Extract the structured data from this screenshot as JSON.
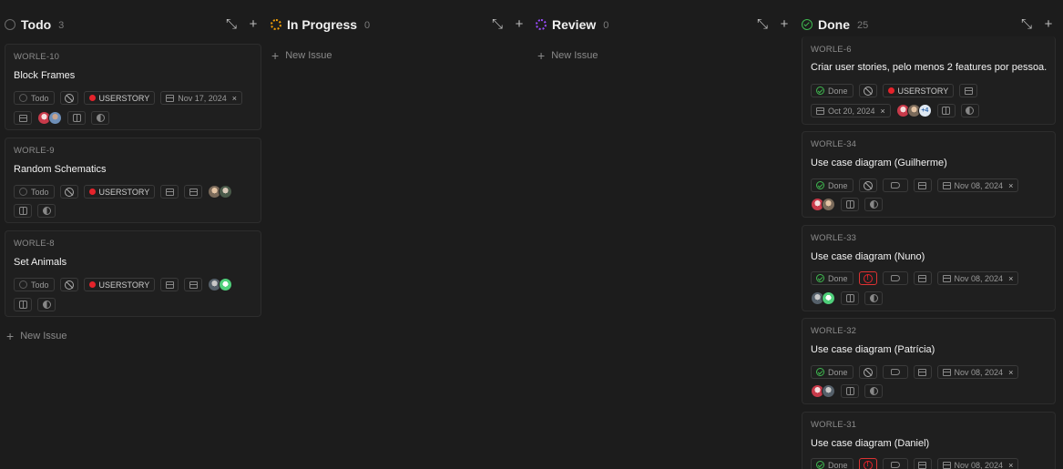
{
  "colors": {
    "todo": "#6b6b6b",
    "in_progress": "#f2a007",
    "review": "#9b4dff",
    "done": "#3fb950",
    "priority": "#e5232b"
  },
  "columns": [
    {
      "key": "todo",
      "title": "Todo",
      "count": "3",
      "icon": "todo-circle-icon"
    },
    {
      "key": "in_progress",
      "title": "In Progress",
      "count": "0",
      "icon": "in-progress-circle-icon"
    },
    {
      "key": "review",
      "title": "Review",
      "count": "0",
      "icon": "review-circle-icon"
    },
    {
      "key": "done",
      "title": "Done",
      "count": "25",
      "icon": "done-check-icon"
    }
  ],
  "new_issue_label": "New Issue",
  "todo_cards": [
    {
      "id": "WORLE-10",
      "title": "Block Frames",
      "state": "Todo",
      "label": "USERSTORY",
      "due": "Nov 17, 2024"
    },
    {
      "id": "WORLE-9",
      "title": "Random Schematics",
      "state": "Todo",
      "label": "USERSTORY"
    },
    {
      "id": "WORLE-8",
      "title": "Set Animals",
      "state": "Todo",
      "label": "USERSTORY"
    }
  ],
  "done_cards": [
    {
      "id": "WORLE-6",
      "title": "Criar user stories, pelo menos 2 features por pessoa.",
      "state": "Done",
      "label": "USERSTORY",
      "due": "Oct 20, 2024",
      "more": "+4"
    },
    {
      "id": "WORLE-34",
      "title": "Use case diagram (Guilherme)",
      "state": "Done",
      "due": "Nov 08, 2024"
    },
    {
      "id": "WORLE-33",
      "title": "Use case diagram (Nuno)",
      "state": "Done",
      "due": "Nov 08, 2024"
    },
    {
      "id": "WORLE-32",
      "title": "Use case diagram (Patrícia)",
      "state": "Done",
      "due": "Nov 08, 2024"
    },
    {
      "id": "WORLE-31",
      "title": "Use case diagram (Daniel)",
      "state": "Done",
      "due": "Nov 08, 2024"
    }
  ]
}
